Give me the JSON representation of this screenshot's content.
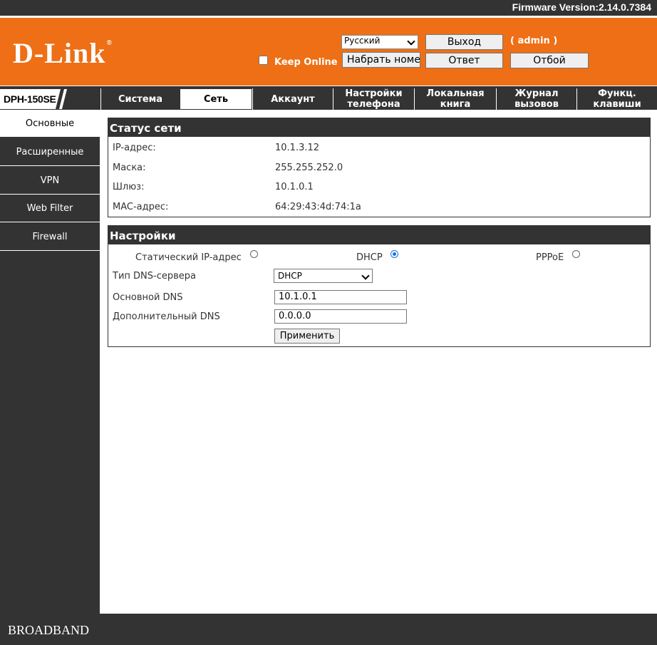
{
  "firmware": "Firmware Version:2.14.0.7384",
  "brand": {
    "logo": "D-Link",
    "registered": "®",
    "accent": "#ee6f15",
    "dark": "#333333"
  },
  "header": {
    "language": "Русский",
    "logout": "Выход",
    "user": "( admin )",
    "keep_online": "Keep Online",
    "dial_placeholder": "Набрать номер",
    "answer": "Ответ",
    "hangup": "Отбой"
  },
  "model": "DPH-150SE",
  "tabs": [
    {
      "label": "Система"
    },
    {
      "label": "Сеть"
    },
    {
      "label": "Аккаунт"
    },
    {
      "label": "Настройки\nтелефона"
    },
    {
      "label": "Локальная\nкнига"
    },
    {
      "label": "Журнал\nвызовов"
    },
    {
      "label": "Функц.\nклавиши"
    }
  ],
  "sidebar": [
    {
      "label": "Основные"
    },
    {
      "label": "Расширенные"
    },
    {
      "label": "VPN"
    },
    {
      "label": "Web Filter"
    },
    {
      "label": "Firewall"
    }
  ],
  "status": {
    "title": "Статус сети",
    "rows": [
      {
        "label": "IP-адрес:",
        "value": "10.1.3.12"
      },
      {
        "label": "Маска:",
        "value": "255.255.252.0"
      },
      {
        "label": "Шлюз:",
        "value": "10.1.0.1"
      },
      {
        "label": "MAC-адрес:",
        "value": "64:29:43:4d:74:1a"
      }
    ]
  },
  "settings": {
    "title": "Настройки",
    "modes": [
      {
        "label": "Статический IP-адрес",
        "selected": false
      },
      {
        "label": "DHCP",
        "selected": true
      },
      {
        "label": "PPPoE",
        "selected": false
      }
    ],
    "dns_type_label": "Тип DNS-сервера",
    "dns_type_value": "DHCP",
    "primary_dns_label": "Основной DNS",
    "primary_dns_value": "10.1.0.1",
    "secondary_dns_label": "Дополнительный DNS",
    "secondary_dns_value": "0.0.0.0",
    "apply": "Применить"
  },
  "footer": "BROADBAND"
}
